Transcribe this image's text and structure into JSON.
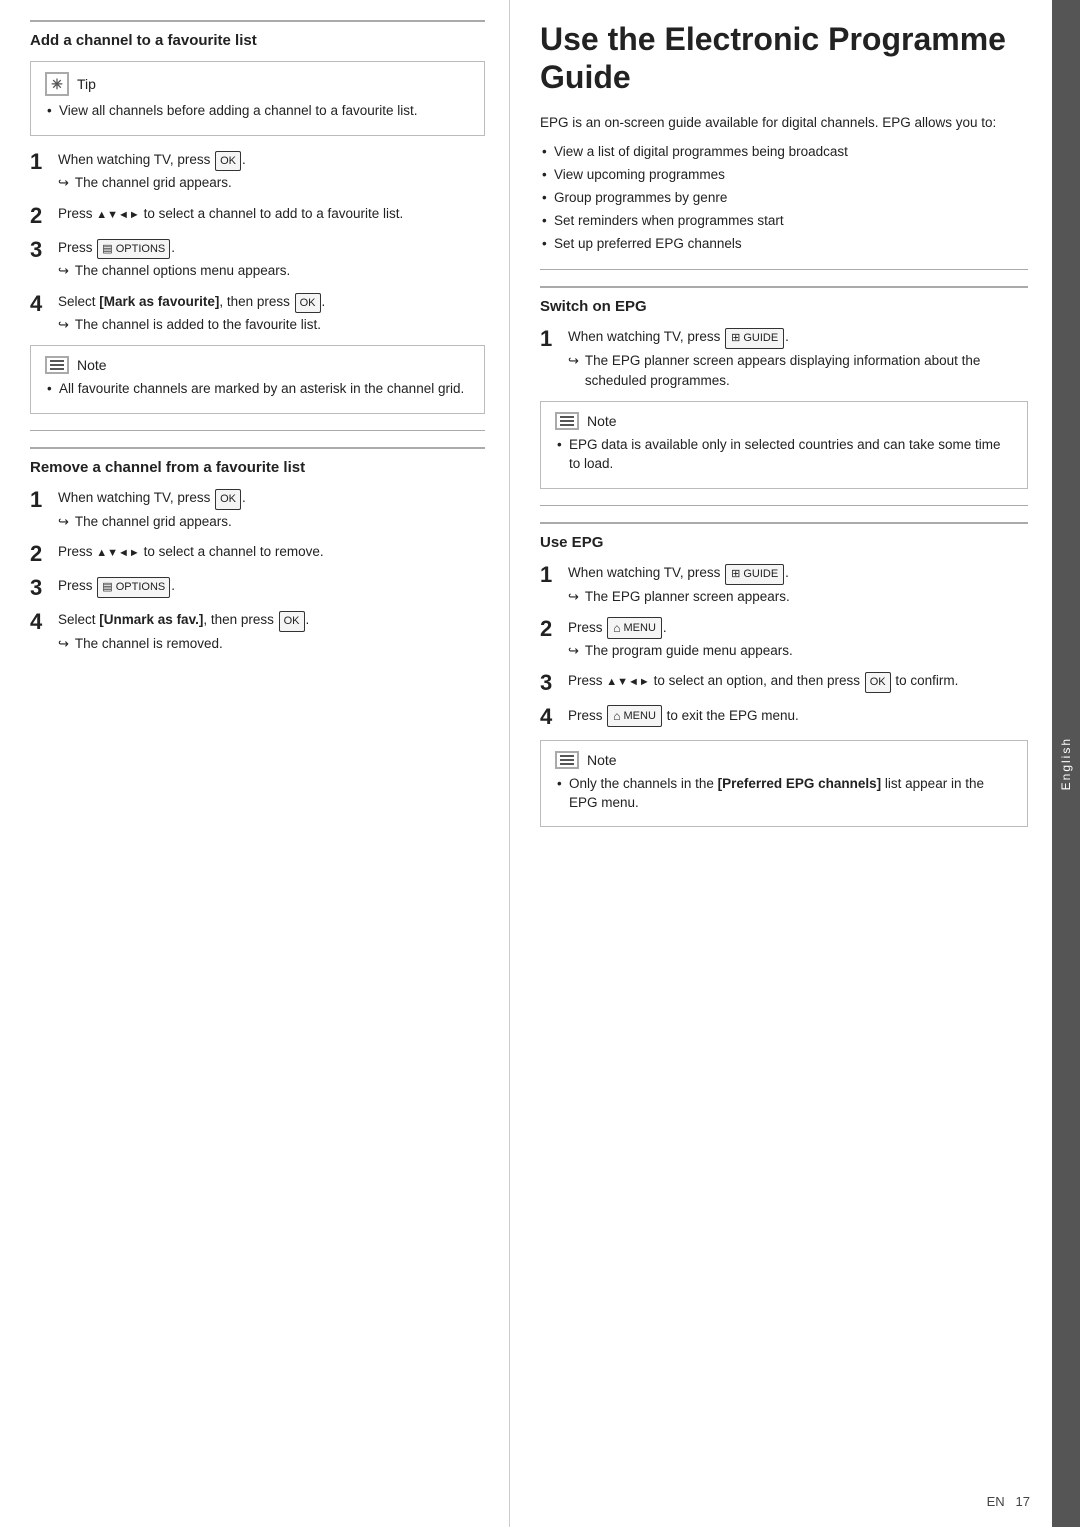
{
  "sidebar": {
    "label": "English"
  },
  "left": {
    "section1": {
      "title": "Add a channel to a favourite list",
      "tip_header": "Tip",
      "tip_bullets": [
        "View all channels before adding a channel to a favourite list."
      ],
      "steps": [
        {
          "num": "1",
          "text": "When watching TV, press OK.",
          "result": "The channel grid appears."
        },
        {
          "num": "2",
          "text": "Press ▲▼◄► to select a channel to add to a favourite list.",
          "result": null
        },
        {
          "num": "3",
          "text": "Press OPTIONS.",
          "result": "The channel options menu appears."
        },
        {
          "num": "4",
          "text": "Select [Mark as favourite], then press OK.",
          "result": "The channel is added to the favourite list."
        }
      ],
      "note_header": "Note",
      "note_bullets": [
        "All favourite channels are marked by an asterisk in the channel grid."
      ]
    },
    "section2": {
      "title": "Remove a channel from a favourite list",
      "steps": [
        {
          "num": "1",
          "text": "When watching TV, press OK.",
          "result": "The channel grid appears."
        },
        {
          "num": "2",
          "text": "Press ▲▼◄► to select a channel to remove.",
          "result": null
        },
        {
          "num": "3",
          "text": "Press OPTIONS.",
          "result": null
        },
        {
          "num": "4",
          "text": "Select [Unmark as fav.], then press OK.",
          "result": "The channel is removed."
        }
      ]
    }
  },
  "right": {
    "section1": {
      "title": "Use the Electronic Programme Guide",
      "intro": "EPG is an on-screen guide available for digital channels. EPG allows you to:",
      "bullets": [
        "View a list of digital programmes being broadcast",
        "View upcoming programmes",
        "Group programmes by genre",
        "Set reminders when programmes start",
        "Set up preferred EPG channels"
      ]
    },
    "section2": {
      "title": "Switch on EPG",
      "steps": [
        {
          "num": "1",
          "text": "When watching TV, press GUIDE.",
          "result": "The EPG planner screen appears displaying information about the scheduled programmes."
        }
      ],
      "note_header": "Note",
      "note_bullets": [
        "EPG data is available only in selected countries and can take some time to load."
      ]
    },
    "section3": {
      "title": "Use EPG",
      "steps": [
        {
          "num": "1",
          "text": "When watching TV, press GUIDE.",
          "result": "The EPG planner screen appears."
        },
        {
          "num": "2",
          "text": "Press MENU.",
          "result": "The program guide menu appears."
        },
        {
          "num": "3",
          "text": "Press ▲▼◄► to select an option, and then press OK to confirm.",
          "result": null
        },
        {
          "num": "4",
          "text": "Press MENU to exit the EPG menu.",
          "result": null
        }
      ],
      "note_header": "Note",
      "note_bullets": [
        "Only the channels in the [Preferred EPG channels] list appear in the EPG menu."
      ]
    }
  },
  "footer": {
    "label": "EN",
    "page_num": "17"
  }
}
